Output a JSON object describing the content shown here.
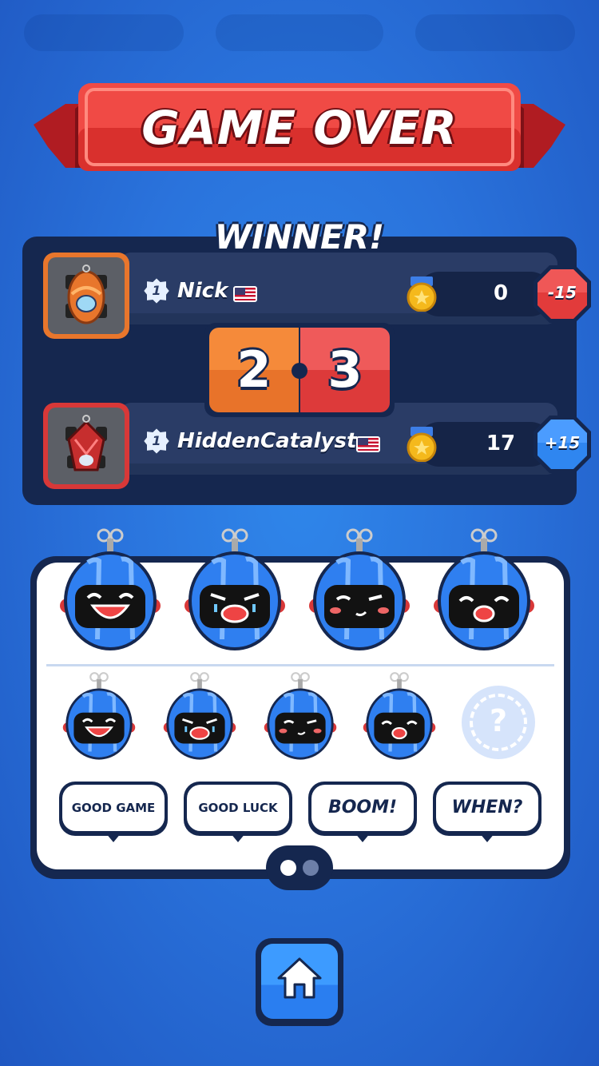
{
  "title": "GAME OVER",
  "winner_label": "WINNER!",
  "players": [
    {
      "name": "Nick",
      "rank": "1",
      "trophies": "0",
      "delta": "-15",
      "frame_color": "#e8762c",
      "delta_color": "#e23b3b"
    },
    {
      "name": "HiddenCatalyst",
      "rank": "1",
      "trophies": "17",
      "delta": "+15",
      "frame_color": "#d83838",
      "delta_color": "#2f86f0"
    }
  ],
  "score": {
    "left": "2",
    "right": "3"
  },
  "emotes_large": [
    "laughing-robot-icon",
    "crying-robot-icon",
    "winking-robot-icon",
    "shocked-robot-icon"
  ],
  "emotes_small": [
    "laughing-robot-icon",
    "crying-robot-icon",
    "winking-robot-icon",
    "shocked-robot-icon"
  ],
  "locked_slot": "?",
  "quick_chat": [
    "GOOD GAME",
    "GOOD LUCK",
    "BOOM!",
    "WHEN?"
  ],
  "pager": {
    "pages": 2,
    "active": 1
  },
  "home_button": "home-icon"
}
